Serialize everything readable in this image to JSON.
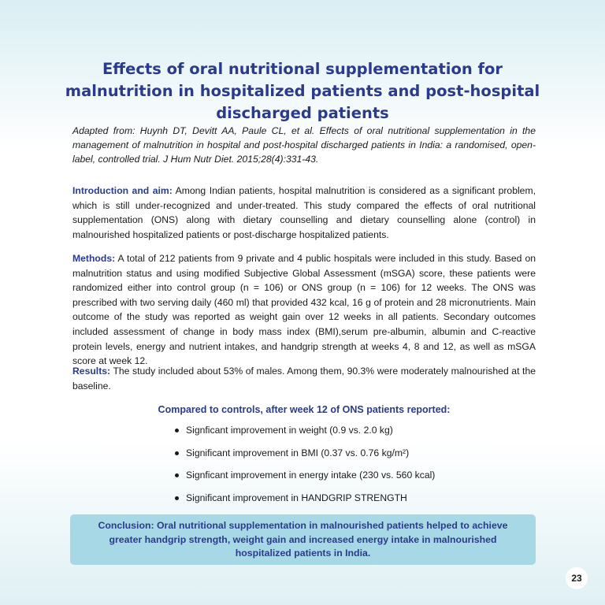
{
  "title": "Effects of oral nutritional supplementation for malnutrition in hospitalized patients and post-hospital discharged patients",
  "source": "Adapted from: Huynh DT, Devitt AA, Paule CL, et al. Effects of oral nutritional supplementation in the management of malnutrition in hospital and post-hospital discharged patients in India: a randomised, open-label, controlled trial. J Hum Nutr Diet. 2015;28(4):331-43.",
  "intro": {
    "label": "Introduction and aim:",
    "text": " Among Indian patients, hospital malnutrition is considered as a significant problem, which is still under-recognized and under-treated. This study compared the effects of oral nutritional supplementation (ONS) along with dietary counselling and dietary counselling alone (control) in malnourished hospitalized patients or post-discharge hospitalized patients."
  },
  "methods": {
    "label": "Methods:",
    "text": " A total of 212 patients from 9 private and 4 public hospitals were included in this study. Based on malnutrition status and using modified Subjective Global Assessment (mSGA) score, these patients were randomized either into control group (n = 106) or ONS group (n = 106) for 12 weeks. The ONS was prescribed with two serving daily (460 ml) that provided 432 kcal, 16 g of protein and 28 micronutrients. Main outcome of the study was reported as weight gain over 12 weeks in all patients. Secondary outcomes included assessment of change in body mass index (BMI),serum pre-albumin, albumin and C-reactive protein levels, energy and nutrient intakes, and handgrip strength at weeks 4, 8 and 12, as well as mSGA score at week 12."
  },
  "results": {
    "label": "Results:",
    "text": " The study included about 53% of males. Among them, 90.3% were moderately malnourished at the baseline."
  },
  "subheading": "Compared to controls, after week 12 of ONS patients reported:",
  "findings": [
    "Signficant improvement in weight (0.9 vs. 2.0 kg)",
    "Significant improvement in BMI (0.37 vs. 0.76 kg/m²)",
    "Signficant improvement in energy intake (230 vs. 560 kcal)",
    "Significant improvement in HANDGRIP STRENGTH"
  ],
  "conclusion": "Conclusion: Oral nutritional supplementation in malnourished patients helped to achieve greater handgrip strength, weight gain and increased energy intake in malnourished hospitalized patients in India.",
  "page_number": "23",
  "colors": {
    "heading": "#2b3b8c",
    "conclusion_bg": "#a7d8e5",
    "page_bg_tint": "#d9eef3"
  }
}
